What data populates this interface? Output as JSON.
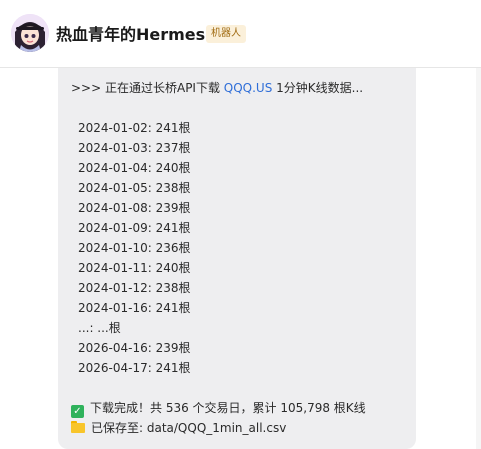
{
  "header": {
    "title": "热血青年的Hermes",
    "badge": "机器人",
    "avatar_icon": "avatar-girl-icon"
  },
  "message": {
    "intro_prefix": ">>> 正在通过长桥API下载 ",
    "intro_symbol": "QQQ.US",
    "intro_suffix": " 1分钟K线数据...",
    "rows": [
      "2024-01-02: 241根",
      "2024-01-03: 237根",
      "2024-01-04: 240根",
      "2024-01-05: 238根",
      "2024-01-08: 239根",
      "2024-01-09: 241根",
      "2024-01-10: 236根",
      "2024-01-11: 240根",
      "2024-01-12: 238根",
      "2024-01-16: 241根",
      "...: ...根",
      "2026-04-16: 239根",
      "2026-04-17: 241根"
    ],
    "complete": "下载完成！共 536 个交易日，累计 105,798 根K线",
    "saved": "已保存至: data/QQQ_1min_all.csv",
    "complete_icon": "check-mark-icon",
    "saved_icon": "folder-icon"
  },
  "colors": {
    "link": "#2f6ed8",
    "bubble_bg": "#eeeef0",
    "badge_bg": "#fbf0da",
    "badge_text": "#a06b12"
  }
}
